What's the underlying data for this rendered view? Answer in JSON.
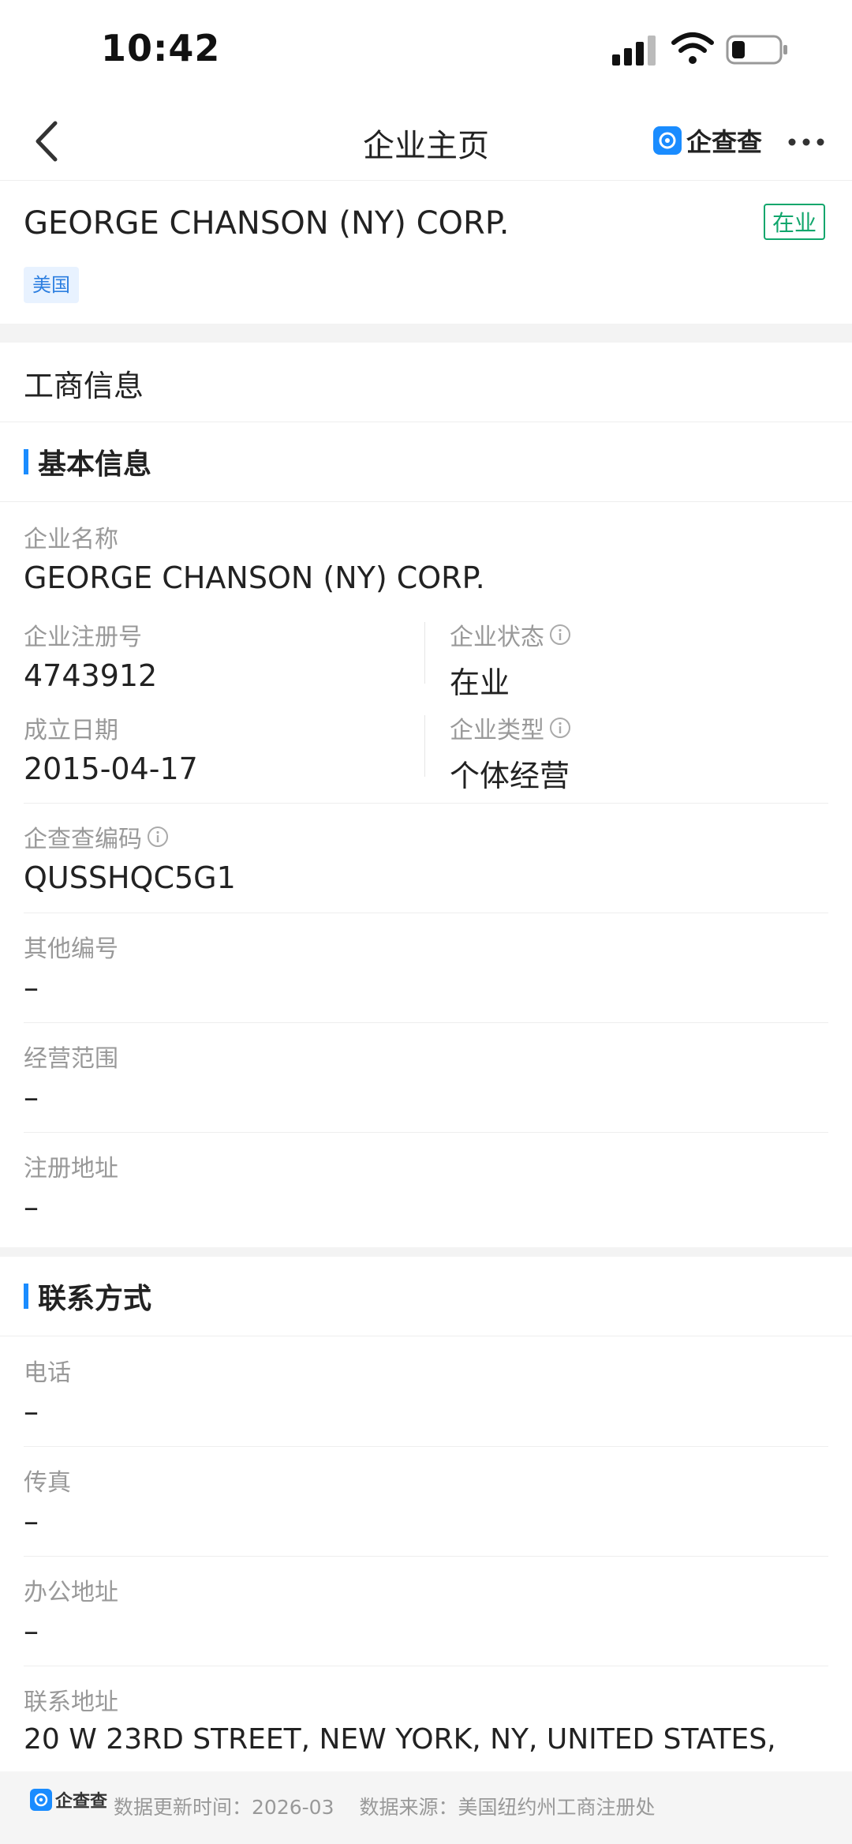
{
  "status_bar": {
    "time": "10:42"
  },
  "nav": {
    "title": "企业主页",
    "brand": "企查查"
  },
  "company": {
    "name": "GEORGE CHANSON (NY) CORP.",
    "status_tag": "在业",
    "country_tag": "美国"
  },
  "section_title": "工商信息",
  "basic_info": {
    "heading": "基本信息",
    "name_label": "企业名称",
    "name_value": "GEORGE CHANSON (NY) CORP.",
    "reg_no_label": "企业注册号",
    "reg_no_value": "4743912",
    "status_label": "企业状态",
    "status_value": "在业",
    "founded_label": "成立日期",
    "founded_value": "2015-04-17",
    "type_label": "企业类型",
    "type_value": "个体经营",
    "qcc_code_label": "企查查编码",
    "qcc_code_value": "QUSSHQC5G1",
    "other_no_label": "其他编号",
    "other_no_value": "–",
    "scope_label": "经营范围",
    "scope_value": "–",
    "reg_addr_label": "注册地址",
    "reg_addr_value": "–"
  },
  "contact": {
    "heading": "联系方式",
    "phone_label": "电话",
    "phone_value": "–",
    "fax_label": "传真",
    "fax_value": "–",
    "office_label": "办公地址",
    "office_value": "–",
    "contact_addr_label": "联系地址",
    "contact_addr_value": "20 W 23RD STREET, NEW YORK, NY, UNITED STATES,"
  },
  "footer": {
    "logo_text": "企查查",
    "update_label": "数据更新时间：",
    "update_value": "2026-03",
    "source_label": "数据来源：",
    "source_value": "美国纽约州工商注册处"
  }
}
